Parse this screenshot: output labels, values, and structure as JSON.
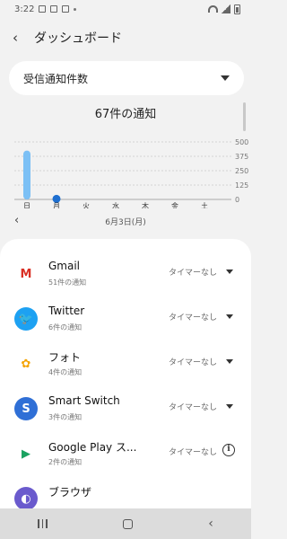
{
  "status": {
    "time": "3:22"
  },
  "header": {
    "back_icon": "‹",
    "title": "ダッシュボード"
  },
  "dropdown": {
    "label": "受信通知件数"
  },
  "chart_title": "67件の通知",
  "chart_data": {
    "type": "bar",
    "categories": [
      "日",
      "月",
      "火",
      "水",
      "木",
      "金",
      "土"
    ],
    "values": [
      425,
      40,
      0,
      0,
      0,
      0,
      0
    ],
    "yticks": [
      "500",
      "375",
      "250",
      "125",
      "0"
    ],
    "ylim": [
      0,
      500
    ],
    "bar_color": "#7cc0f5",
    "highlight_color": "#1e6fd0",
    "highlight_index": 1
  },
  "date": {
    "label": "6月3日(月)",
    "prev_icon": "‹"
  },
  "apps": [
    {
      "name": "Gmail",
      "sub": "51件の通知",
      "timer": "タイマーなし",
      "control": "caret",
      "icon": "gmail-icon",
      "color": "#ffffff",
      "glyph": "M",
      "glyph_color": "#d93025"
    },
    {
      "name": "Twitter",
      "sub": "6件の通知",
      "timer": "タイマーなし",
      "control": "caret",
      "icon": "twitter-icon",
      "color": "#1da1f2",
      "glyph": "🐦",
      "glyph_color": "#ffffff"
    },
    {
      "name": "フォト",
      "sub": "4件の通知",
      "timer": "タイマーなし",
      "control": "caret",
      "icon": "photos-icon",
      "color": "#ffffff",
      "glyph": "✿",
      "glyph_color": "#f4a300"
    },
    {
      "name": "Smart Switch",
      "sub": "3件の通知",
      "timer": "タイマーなし",
      "control": "caret",
      "icon": "smart-switch-icon",
      "color": "#2f6fd6",
      "glyph": "S",
      "glyph_color": "#ffffff"
    },
    {
      "name": "Google Play ス...",
      "sub": "2件の通知",
      "timer": "タイマーなし",
      "control": "info",
      "icon": "play-store-icon",
      "color": "#ffffff",
      "glyph": "▶",
      "glyph_color": "#1aa260"
    },
    {
      "name": "ブラウザ",
      "sub": "",
      "timer": "",
      "control": "none",
      "icon": "browser-icon",
      "color": "#6a5acd",
      "glyph": "◐",
      "glyph_color": "#ffffff"
    }
  ],
  "navbar": {
    "back_icon": "‹"
  }
}
